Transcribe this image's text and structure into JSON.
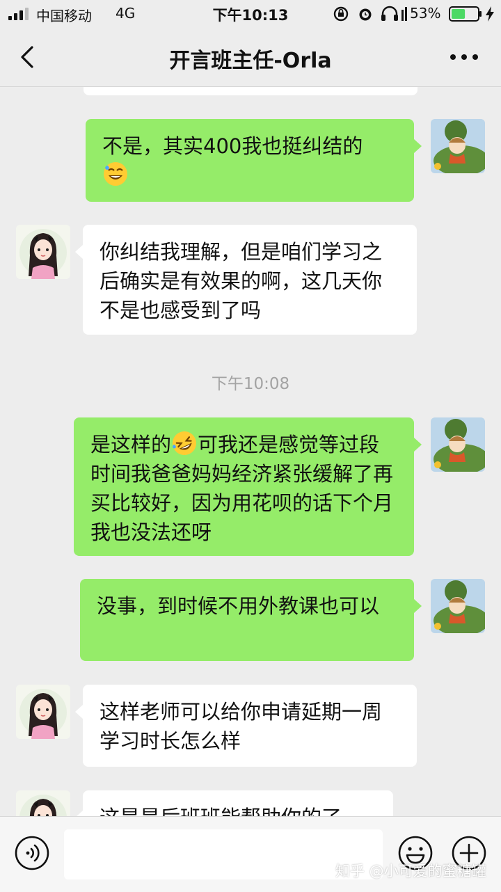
{
  "status_bar": {
    "carrier": "中国移动",
    "network": "4G",
    "time": "下午10:13",
    "battery_percent": "53%",
    "battery_level": 0.53,
    "icons": [
      "signal-icon",
      "rotation-lock-icon",
      "alarm-icon",
      "headphones-icon",
      "battery-icon",
      "charging-icon"
    ]
  },
  "nav": {
    "title": "开言班主任-Orla",
    "back_icon": "chevron-left-icon",
    "more_icon": "more-dots-icon"
  },
  "messages": [
    {
      "from": "them",
      "text": ""
    },
    {
      "from": "me",
      "text": "不是，其实400我也挺纠结的",
      "emoji": "grinning-sweat-emoji"
    },
    {
      "from": "them",
      "text": "你纠结我理解，但是咱们学习之后确实是有效果的啊，这几天你不是也感受到了吗"
    },
    {
      "type": "timestamp",
      "text": "下午10:08"
    },
    {
      "from": "me",
      "text_before": "是这样的",
      "emoji": "rolling-laughing-emoji",
      "text_after": "可我还是感觉等过段时间我爸爸妈妈经济紧张缓解了再买比较好，因为用花呗的话下个月我也没法还呀"
    },
    {
      "from": "me",
      "text": "没事，到时候不用外教课也可以"
    },
    {
      "from": "them",
      "text": "这样老师可以给你申请延期一周学习时长怎么样"
    },
    {
      "from": "them",
      "text": "这是是后班班能帮助你的了"
    }
  ],
  "input_bar": {
    "voice_icon": "voice-icon",
    "emoji_icon": "smiley-icon",
    "plus_icon": "plus-circle-icon",
    "value": ""
  },
  "watermark": "知乎 @小可爱的蜜糖罐",
  "colors": {
    "background": "#ededed",
    "my_bubble": "#95ec69",
    "their_bubble": "#ffffff",
    "battery_fill": "#4cd964"
  }
}
